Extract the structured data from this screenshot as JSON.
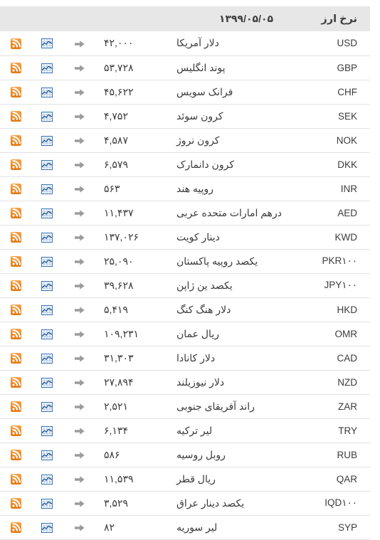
{
  "header": {
    "title": "نرخ ارز",
    "date": "۱۳۹۹/۰۵/۰۵",
    "blank_chart": "",
    "blank_arrow": "",
    "blank_rss": ""
  },
  "colors": {
    "header_bg": "#e7e7e7",
    "row_border": "#e2e2e2",
    "text": "#3b3b3b",
    "rss_orange": "#f08a24",
    "chart_blue": "#2f6fb5",
    "arrow_gray": "#9b9b9b",
    "page_bg": "#ffffff"
  },
  "icons": {
    "rss": "rss-icon",
    "chart": "chart-icon",
    "arrow": "arrow-right-icon"
  },
  "table": {
    "columns": [
      "نرخ ارز",
      "۱۳۹۹/۰۵/۰۵",
      "",
      "",
      ""
    ],
    "rows": [
      {
        "code": "USD",
        "name": "دلار آمریکا",
        "value": "۴۲,۰۰۰"
      },
      {
        "code": "GBP",
        "name": "پوند انگلیس",
        "value": "۵۳,۷۲۸"
      },
      {
        "code": "CHF",
        "name": "فرانک سویس",
        "value": "۴۵,۶۲۲"
      },
      {
        "code": "SEK",
        "name": "کرون سوئد",
        "value": "۴,۷۵۲"
      },
      {
        "code": "NOK",
        "name": "کرون نروژ",
        "value": "۴,۵۸۷"
      },
      {
        "code": "DKK",
        "name": "کرون دانمارک",
        "value": "۶,۵۷۹"
      },
      {
        "code": "INR",
        "name": "روپیه هند",
        "value": "۵۶۳"
      },
      {
        "code": "AED",
        "name": "درهم امارات متحده عربی",
        "value": "۱۱,۴۳۷"
      },
      {
        "code": "KWD",
        "name": "دینار کویت",
        "value": "۱۳۷,۰۲۶"
      },
      {
        "code": "PKR۱۰۰",
        "name": "یکصد روپیه پاکستان",
        "value": "۲۵,۰۹۰"
      },
      {
        "code": "JPY۱۰۰",
        "name": "یکصد ین ژاپن",
        "value": "۳۹,۶۲۸"
      },
      {
        "code": "HKD",
        "name": "دلار هنگ کنگ",
        "value": "۵,۴۱۹"
      },
      {
        "code": "OMR",
        "name": "ریال عمان",
        "value": "۱۰۹,۲۳۱"
      },
      {
        "code": "CAD",
        "name": "دلار کانادا",
        "value": "۳۱,۳۰۳"
      },
      {
        "code": "NZD",
        "name": "دلار نیوزیلند",
        "value": "۲۷,۸۹۴"
      },
      {
        "code": "ZAR",
        "name": "راند آفریقای جنوبی",
        "value": "۲,۵۲۱"
      },
      {
        "code": "TRY",
        "name": "لیر ترکیه",
        "value": "۶,۱۳۴"
      },
      {
        "code": "RUB",
        "name": "روبل روسیه",
        "value": "۵۸۶"
      },
      {
        "code": "QAR",
        "name": "ریال قطر",
        "value": "۱۱,۵۳۹"
      },
      {
        "code": "IQD۱۰۰",
        "name": "یکصد دینار عراق",
        "value": "۳,۵۲۹"
      },
      {
        "code": "SYP",
        "name": "لیر سوریه",
        "value": "۸۲"
      }
    ]
  }
}
